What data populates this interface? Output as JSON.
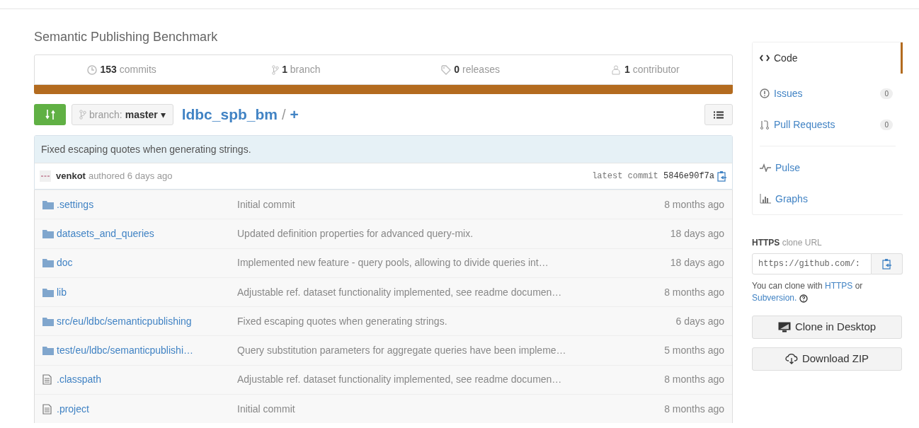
{
  "repo_description": "Semantic Publishing Benchmark",
  "stats": [
    {
      "kind": "commits",
      "count": "153",
      "label": "commits"
    },
    {
      "kind": "branch",
      "count": "1",
      "label": "branch"
    },
    {
      "kind": "releases",
      "count": "0",
      "label": "releases"
    },
    {
      "kind": "contributors",
      "count": "1",
      "label": "contributor"
    }
  ],
  "branch_selector": {
    "prefix": "branch:",
    "branch": "master",
    "caret": "▾"
  },
  "breadcrumb": {
    "repo": "ldbc_spb_bm",
    "separator": "/",
    "add": "+"
  },
  "commit": {
    "message": "Fixed escaping quotes when generating strings.",
    "author": "venkot",
    "action": "authored 6 days ago",
    "label": "latest commit",
    "sha": "5846e90f7a"
  },
  "files": [
    {
      "kind": "folder",
      "name": ".settings",
      "message": "Initial commit",
      "age": "8 months ago"
    },
    {
      "kind": "folder",
      "name": "datasets_and_queries",
      "message": "Updated definition properties for advanced query-mix.",
      "age": "18 days ago"
    },
    {
      "kind": "folder",
      "name": "doc",
      "message": "Implemented new feature - query pools, allowing to divide queries int…",
      "age": "18 days ago"
    },
    {
      "kind": "folder",
      "name": "lib",
      "message": "Adjustable ref. dataset functionality implemented, see readme documen…",
      "age": "8 months ago"
    },
    {
      "kind": "folder",
      "name": "src/eu/ldbc/semanticpublishing",
      "message": "Fixed escaping quotes when generating strings.",
      "age": "6 days ago"
    },
    {
      "kind": "folder",
      "name": "test/eu/ldbc/semanticpublishi…",
      "message": "Query substitution parameters for aggregate queries have been impleme…",
      "age": "5 months ago"
    },
    {
      "kind": "file",
      "name": ".classpath",
      "message": "Adjustable ref. dataset functionality implemented, see readme documen…",
      "age": "8 months ago"
    },
    {
      "kind": "file",
      "name": ".project",
      "message": "Initial commit",
      "age": "8 months ago"
    }
  ],
  "nav": [
    {
      "kind": "code",
      "label": "Code",
      "selected": true
    },
    {
      "kind": "issues",
      "label": "Issues",
      "count": "0",
      "selected": false
    },
    {
      "kind": "pulls",
      "label": "Pull Requests",
      "count": "0",
      "selected": false
    },
    {
      "kind": "pulse",
      "label": "Pulse",
      "selected": false
    },
    {
      "kind": "graphs",
      "label": "Graphs",
      "selected": false
    }
  ],
  "clone": {
    "protocol": "HTTPS",
    "title": "clone URL",
    "url": "https://github.com/:",
    "help_prefix": "You can clone with",
    "help_https": "HTTPS",
    "help_or": "or",
    "help_svn": "Subversion."
  },
  "buttons": [
    {
      "kind": "desktop",
      "label": "Clone in Desktop"
    },
    {
      "kind": "zip",
      "label": "Download ZIP"
    }
  ]
}
